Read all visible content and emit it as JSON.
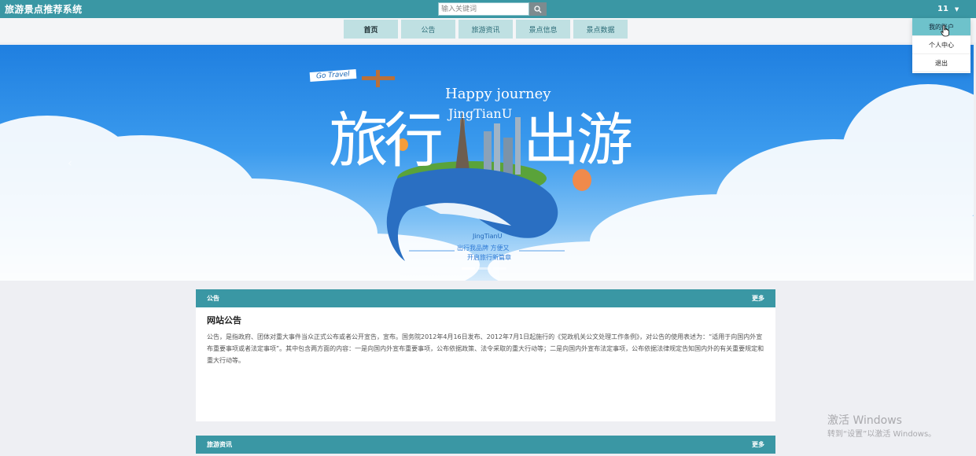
{
  "app": {
    "title": "旅游景点推荐系统"
  },
  "search": {
    "placeholder": "输入关键词"
  },
  "user": {
    "name": "11",
    "menu": [
      "我的账户",
      "个人中心",
      "退出"
    ]
  },
  "nav": {
    "items": [
      "首页",
      "公告",
      "旅游资讯",
      "景点信息",
      "景点数据"
    ]
  },
  "banner": {
    "go_tag": "Go Travel",
    "line1": "Happy journey",
    "line2": "JingTianU",
    "big_left": "旅行",
    "big_right": "出游",
    "sub1": "JingTianU",
    "sub2": "出行我品牌 方便又",
    "sub3": "开启旅行新篇章",
    "active_slide": 1
  },
  "notice": {
    "header": "公告",
    "more": "更多",
    "title": "网站公告",
    "text": "公告，是指政府、团体对重大事件当众正式公布或者公开宣告，宣布。国务院2012年4月16日发布、2012年7月1日起施行的《党政机关公文处理工作条例》，对公告的使用表述为：“适用于向国内外宣布重要事项或者法定事项”。其中包含两方面的内容：一是向国内外宣布重要事项，公布依据政策、法令采取的重大行动等；二是向国内外宣布法定事项，公布依据法律规定告知国内外的有关重要规定和重大行动等。"
  },
  "news": {
    "header": "旅游资讯",
    "more": "更多"
  },
  "watermark": {
    "line1": "激活 Windows",
    "line2": "转到“设置”以激活 Windows。"
  },
  "colors": {
    "accent": "#3a97a4",
    "nav_bg": "#bfe0e2",
    "menu_active": "#6ec2cb"
  }
}
